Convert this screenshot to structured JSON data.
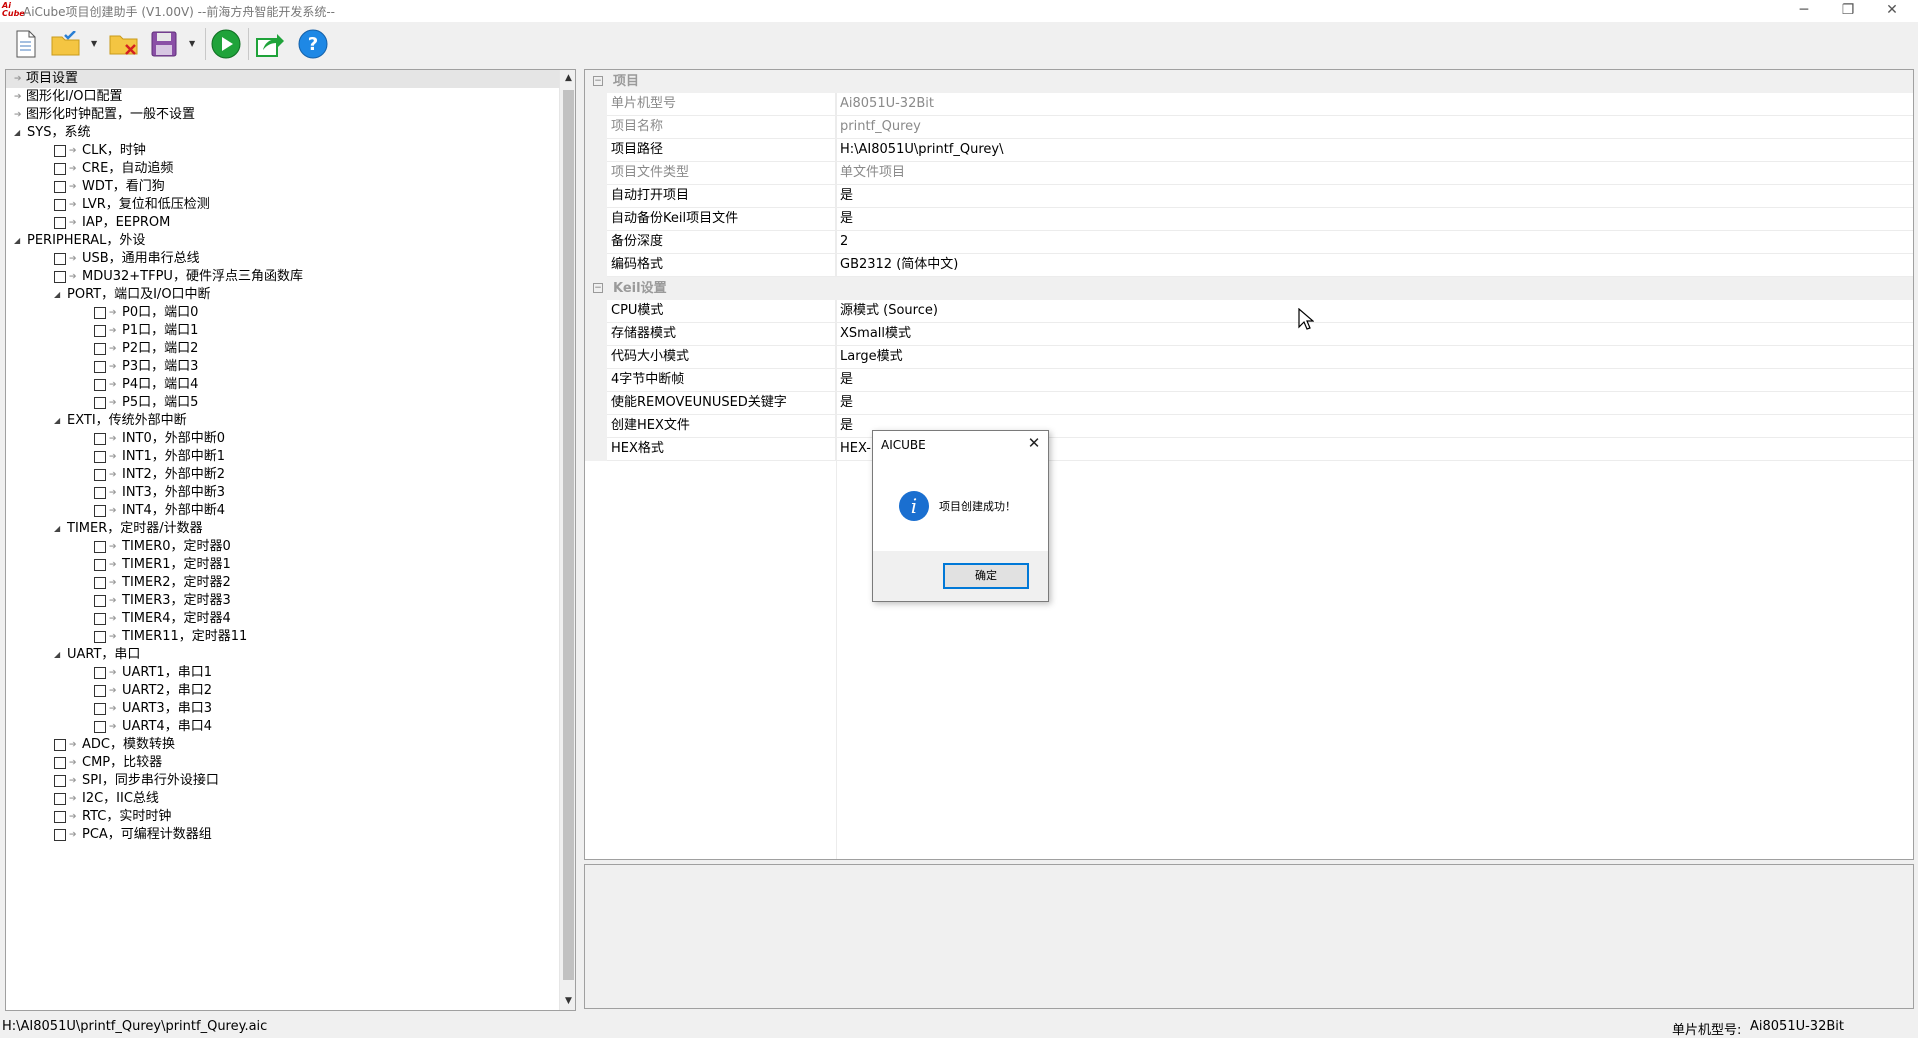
{
  "window": {
    "title": "AiCube项目创建助手 (V1.00V) --前海方舟智能开发系统--",
    "app_icon_text": "AiCube",
    "controls": [
      "minimize",
      "restore",
      "close"
    ]
  },
  "toolbar": {
    "buttons": [
      {
        "name": "new-project",
        "icon": "document-icon"
      },
      {
        "name": "open-project",
        "icon": "folder-check-icon",
        "dropdown": true
      },
      {
        "name": "close-project",
        "icon": "folder-x-icon"
      },
      {
        "name": "save-project",
        "icon": "floppy-disk-icon",
        "dropdown": true
      },
      {
        "name": "run",
        "icon": "play-icon"
      },
      {
        "name": "export",
        "icon": "export-icon"
      },
      {
        "name": "help",
        "icon": "help-icon"
      }
    ]
  },
  "tree": {
    "items": [
      {
        "label": "项目设置",
        "selected": true,
        "type": "leaf-arrow",
        "depth": 0
      },
      {
        "label": "图形化I/O口配置",
        "type": "leaf-arrow",
        "depth": 0
      },
      {
        "label": "图形化时钟配置，一般不设置",
        "type": "leaf-arrow",
        "depth": 0
      },
      {
        "label": "SYS，系统",
        "type": "group",
        "depth": 0
      },
      {
        "label": "CLK，时钟",
        "type": "check",
        "depth": 1
      },
      {
        "label": "CRE，自动追频",
        "type": "check",
        "depth": 1
      },
      {
        "label": "WDT，看门狗",
        "type": "check",
        "depth": 1
      },
      {
        "label": "LVR，复位和低压检测",
        "type": "check",
        "depth": 1
      },
      {
        "label": "IAP，EEPROM",
        "type": "check",
        "depth": 1
      },
      {
        "label": "PERIPHERAL，外设",
        "type": "group",
        "depth": 0
      },
      {
        "label": "USB，通用串行总线",
        "type": "check",
        "depth": 1
      },
      {
        "label": "MDU32+TFPU，硬件浮点三角函数库",
        "type": "check",
        "depth": 1
      },
      {
        "label": "PORT，端口及I/O口中断",
        "type": "group",
        "depth": 1
      },
      {
        "label": "P0口，端口0",
        "type": "check",
        "depth": 2
      },
      {
        "label": "P1口，端口1",
        "type": "check",
        "depth": 2
      },
      {
        "label": "P2口，端口2",
        "type": "check",
        "depth": 2
      },
      {
        "label": "P3口，端口3",
        "type": "check",
        "depth": 2
      },
      {
        "label": "P4口，端口4",
        "type": "check",
        "depth": 2
      },
      {
        "label": "P5口，端口5",
        "type": "check",
        "depth": 2
      },
      {
        "label": "EXTI，传统外部中断",
        "type": "group",
        "depth": 1
      },
      {
        "label": "INT0，外部中断0",
        "type": "check",
        "depth": 2
      },
      {
        "label": "INT1，外部中断1",
        "type": "check",
        "depth": 2
      },
      {
        "label": "INT2，外部中断2",
        "type": "check",
        "depth": 2
      },
      {
        "label": "INT3，外部中断3",
        "type": "check",
        "depth": 2
      },
      {
        "label": "INT4，外部中断4",
        "type": "check",
        "depth": 2
      },
      {
        "label": "TIMER，定时器/计数器",
        "type": "group",
        "depth": 1
      },
      {
        "label": "TIMER0，定时器0",
        "type": "check",
        "depth": 2
      },
      {
        "label": "TIMER1，定时器1",
        "type": "check",
        "depth": 2
      },
      {
        "label": "TIMER2，定时器2",
        "type": "check",
        "depth": 2
      },
      {
        "label": "TIMER3，定时器3",
        "type": "check",
        "depth": 2
      },
      {
        "label": "TIMER4，定时器4",
        "type": "check",
        "depth": 2
      },
      {
        "label": "TIMER11，定时器11",
        "type": "check",
        "depth": 2
      },
      {
        "label": "UART，串口",
        "type": "group",
        "depth": 1
      },
      {
        "label": "UART1，串口1",
        "type": "check",
        "depth": 2
      },
      {
        "label": "UART2，串口2",
        "type": "check",
        "depth": 2
      },
      {
        "label": "UART3，串口3",
        "type": "check",
        "depth": 2
      },
      {
        "label": "UART4，串口4",
        "type": "check",
        "depth": 2
      },
      {
        "label": "ADC，模数转换",
        "type": "check",
        "depth": 1
      },
      {
        "label": "CMP，比较器",
        "type": "check",
        "depth": 1
      },
      {
        "label": "SPI，同步串行外设接口",
        "type": "check",
        "depth": 1
      },
      {
        "label": "I2C，IIC总线",
        "type": "check",
        "depth": 1
      },
      {
        "label": "RTC，实时时钟",
        "type": "check",
        "depth": 1
      },
      {
        "label": "PCA，可编程计数器组",
        "type": "check",
        "depth": 1
      }
    ]
  },
  "properties": {
    "categories": [
      {
        "name": "项目",
        "rows": [
          {
            "key": "单片机型号",
            "value": "Ai8051U-32Bit",
            "readonly": true
          },
          {
            "key": "项目名称",
            "value": "printf_Qurey",
            "readonly": true
          },
          {
            "key": "项目路径",
            "value": "H:\\AI8051U\\printf_Qurey\\",
            "readonly": false
          },
          {
            "key": "项目文件类型",
            "value": "单文件项目",
            "readonly": true
          },
          {
            "key": "自动打开项目",
            "value": "是",
            "readonly": false
          },
          {
            "key": "自动备份Keil项目文件",
            "value": "是",
            "readonly": false
          },
          {
            "key": "备份深度",
            "value": "2",
            "readonly": false
          },
          {
            "key": "编码格式",
            "value": "GB2312 (简体中文)",
            "readonly": false
          }
        ]
      },
      {
        "name": "Keil设置",
        "rows": [
          {
            "key": "CPU模式",
            "value": "源模式 (Source)",
            "readonly": false
          },
          {
            "key": "存储器模式",
            "value": "XSmall模式",
            "readonly": false
          },
          {
            "key": "代码大小模式",
            "value": "Large模式",
            "readonly": false
          },
          {
            "key": "4字节中断帧",
            "value": "是",
            "readonly": false
          },
          {
            "key": "使能REMOVEUNUSED关键字",
            "value": "是",
            "readonly": false
          },
          {
            "key": "创建HEX文件",
            "value": "是",
            "readonly": false
          },
          {
            "key": "HEX格式",
            "value": "HEX-",
            "readonly": false
          }
        ]
      }
    ]
  },
  "dialog": {
    "title": "AICUBE",
    "message": "项目创建成功！",
    "ok_label": "确定",
    "icon": "info-icon"
  },
  "statusbar": {
    "path": "H:\\AI8051U\\printf_Qurey\\printf_Qurey.aic",
    "chip_label": "单片机型号:",
    "chip_value": "Ai8051U-32Bit"
  },
  "colors": {
    "accent": "#0078d7",
    "info_blue": "#1a6fd0",
    "readonly_text": "#8a8a8a",
    "run_green": "#1fa33a"
  }
}
